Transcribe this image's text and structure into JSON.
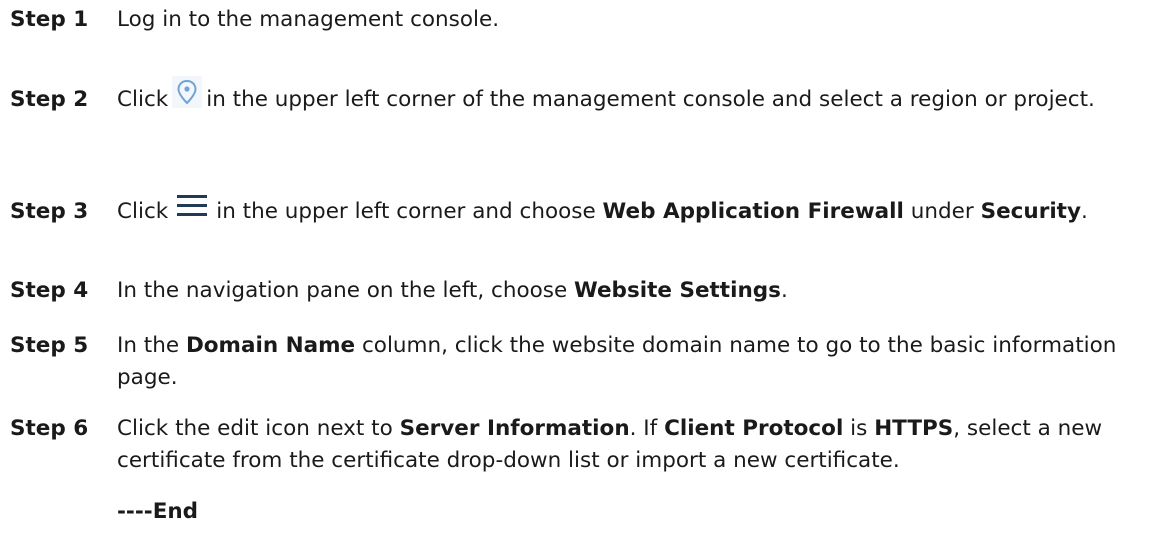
{
  "steps": [
    {
      "label": "Step 1",
      "t1": "Log in to the management console."
    },
    {
      "label": "Step 2",
      "t1": "Click",
      "icon": "location-pin-icon",
      "t2": "in the upper left corner of the management console and select a region or project."
    },
    {
      "label": "Step 3",
      "t1": "Click",
      "icon": "menu-icon",
      "t2": "in the upper left corner and choose",
      "b1": "Web Application Firewall",
      "t3": "under",
      "b2": "Security",
      "t4": "."
    },
    {
      "label": "Step 4",
      "t1": "In the navigation pane on the left, choose",
      "b1": "Website Settings",
      "t2": "."
    },
    {
      "label": "Step 5",
      "t1": "In the",
      "b1": "Domain Name",
      "t2": "column, click the website domain name to go to the basic information page."
    },
    {
      "label": "Step 6",
      "t1": "Click the edit icon next to",
      "b1": "Server Information",
      "t2": ". If",
      "b2": "Client Protocol",
      "t3": "is",
      "b3": "HTTPS",
      "t4": ", select a new certificate from the certificate drop-down list or import a new certificate."
    }
  ],
  "end_mark": "----End",
  "colors": {
    "text": "#1a1a1a",
    "location_icon": "#6fa4d8",
    "menu_icon": "#1f3b57"
  }
}
